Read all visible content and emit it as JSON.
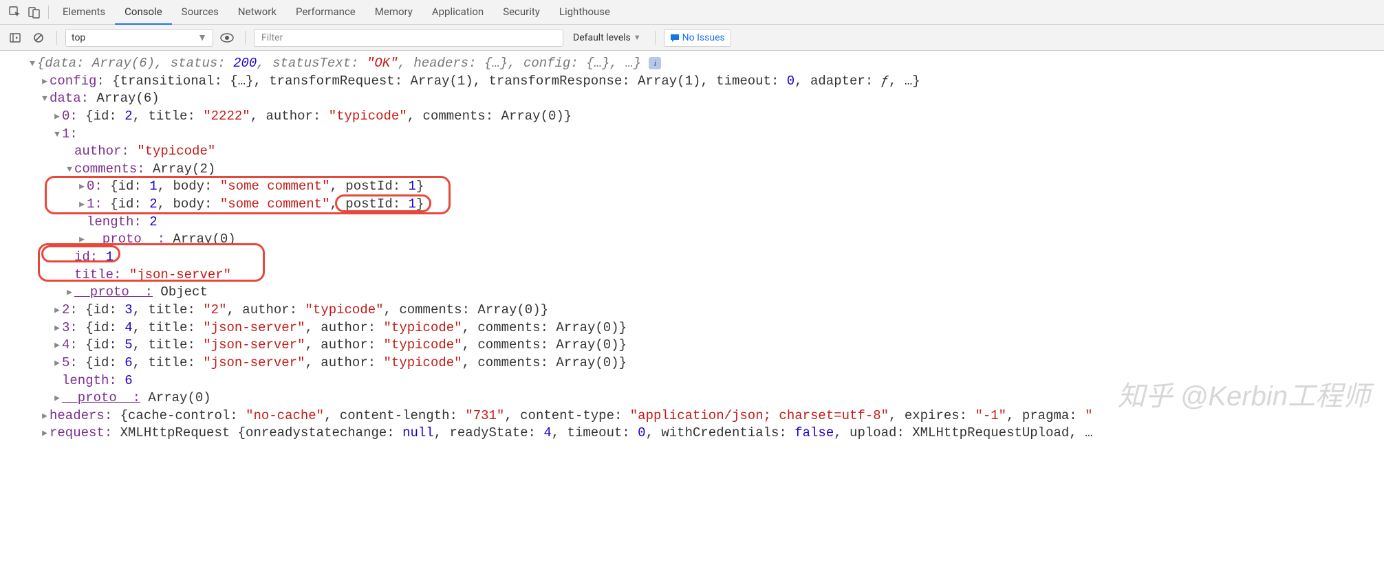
{
  "toolbar": {
    "tabs": [
      "Elements",
      "Console",
      "Sources",
      "Network",
      "Performance",
      "Memory",
      "Application",
      "Security",
      "Lighthouse"
    ],
    "active_tab": "Console"
  },
  "subtoolbar": {
    "context": "top",
    "filter_placeholder": "Filter",
    "levels_label": "Default levels",
    "issues_label": "No Issues"
  },
  "console": {
    "top_line_parts": {
      "prefix": "{data: ",
      "array6": "Array(6)",
      "status_k": ", status: ",
      "status_v": "200",
      "statusText_k": ", statusText: ",
      "statusText_v": "\"OK\"",
      "headers_k": ", headers: ",
      "headers_v": "{…}",
      "config_k": ", config: ",
      "config_v": "{…}",
      "suffix": ", …}"
    },
    "config_line": {
      "key": "config:",
      "rest": " {transitional: {…}, transformRequest: Array(1), transformResponse: Array(1), timeout: ",
      "timeout": "0",
      "rest2": ", adapter: ",
      "fn": "ƒ",
      "rest3": ", …}"
    },
    "data_key": "data:",
    "data_type": " Array(6)",
    "item0": {
      "idx": "0:",
      "body": " {id: ",
      "id": "2",
      "title_k": ", title: ",
      "title_v": "\"2222\"",
      "author_k": ", author: ",
      "author_v": "\"typicode\"",
      "comments_k": ", comments: ",
      "comments_v": "Array(0)",
      "close": "}"
    },
    "item1": {
      "idx": "1:",
      "author_k": "author:",
      "author_v": " \"typicode\"",
      "comments_k": "comments:",
      "comments_type": " Array(2)",
      "c0": {
        "idx": "0:",
        "body": " {id: ",
        "id": "1",
        "bk": ", body: ",
        "bv": "\"some comment\"",
        "pk": ", postId: ",
        "pv": "1",
        "close": "}"
      },
      "c1": {
        "idx": "1:",
        "body": " {id: ",
        "id": "2",
        "bk": ", body: ",
        "bv": "\"some comment\"",
        "pk": ", postId: ",
        "pv": "1",
        "close": "}"
      },
      "length_k": "length:",
      "length_v": " 2",
      "proto_k": "__proto__:",
      "proto_v": " Array(0)",
      "id_k": "id:",
      "id_v": " 1",
      "title_k": "title:",
      "title_v": " \"json-server\"",
      "outer_proto_k": "__proto__:",
      "outer_proto_v": " Object"
    },
    "rows_rest": [
      {
        "idx": "2:",
        "id": "3",
        "title": "\"2\"",
        "author": "\"typicode\"",
        "comments": "Array(0)"
      },
      {
        "idx": "3:",
        "id": "4",
        "title": "\"json-server\"",
        "author": "\"typicode\"",
        "comments": "Array(0)"
      },
      {
        "idx": "4:",
        "id": "5",
        "title": "\"json-server\"",
        "author": "\"typicode\"",
        "comments": "Array(0)"
      },
      {
        "idx": "5:",
        "id": "6",
        "title": "\"json-server\"",
        "author": "\"typicode\"",
        "comments": "Array(0)"
      }
    ],
    "data_length_k": "length:",
    "data_length_v": " 6",
    "data_proto_k": "__proto__:",
    "data_proto_v": " Array(0)",
    "headers_line": {
      "key": "headers:",
      "body": " {cache-control: ",
      "v1": "\"no-cache\"",
      "k2": ", content-length: ",
      "v2": "\"731\"",
      "k3": ", content-type: ",
      "v3": "\"application/json; charset=utf-8\"",
      "k4": ", expires: ",
      "v4": "\"-1\"",
      "k5": ", pragma: ",
      "v5": "\"",
      "close": ""
    },
    "request_line": {
      "key": "request:",
      "body": " XMLHttpRequest {onreadystatechange: ",
      "v1": "null",
      "k2": ", readyState: ",
      "v2": "4",
      "k3": ", timeout: ",
      "v3": "0",
      "k4": ", withCredentials: ",
      "v4": "false",
      "k5": ", upload: XMLHttpRequestUpload, …"
    }
  },
  "watermark": "知乎 @Kerbin工程师"
}
